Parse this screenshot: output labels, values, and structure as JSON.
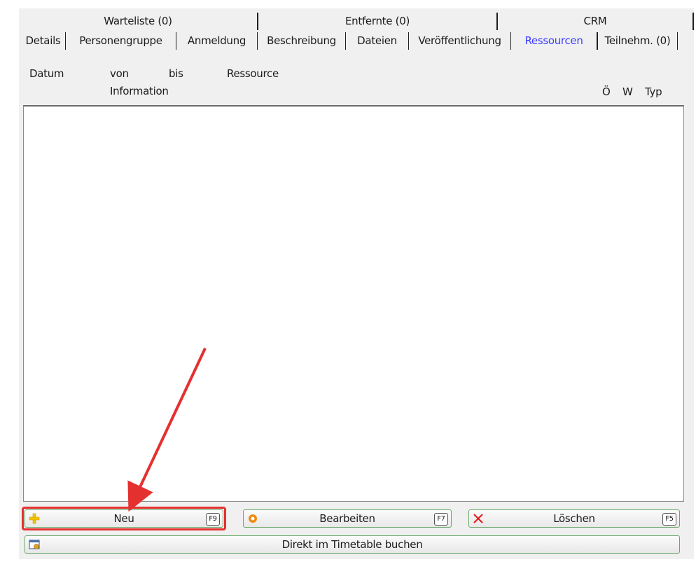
{
  "tabs_top": [
    "Warteliste (0)",
    "Entfernte (0)",
    "CRM"
  ],
  "tabs_bottom": [
    "Details",
    "Personengruppe",
    "Anmeldung",
    "Beschreibung",
    "Dateien",
    "Veröffentlichung",
    "Ressourcen",
    "Teilnehm. (0)"
  ],
  "active_tab": "Ressourcen",
  "list_header": {
    "datum": "Datum",
    "von": "von",
    "bis": "bis",
    "ressource": "Ressource",
    "information": "Information",
    "oe": "Ö",
    "w": "W",
    "typ": "Typ"
  },
  "buttons": {
    "neu": {
      "label": "Neu",
      "key": "F9"
    },
    "bearbeiten": {
      "label": "Bearbeiten",
      "key": "F7"
    },
    "loeschen": {
      "label": "Löschen",
      "key": "F5"
    },
    "timetable": {
      "label": "Direkt im Timetable buchen"
    }
  },
  "colors": {
    "active_tab": "#3d3dff",
    "annotation": "#e53030",
    "button_border": "#6aa86a"
  },
  "icons": {
    "neu": "plus-icon",
    "bearbeiten": "edit-gear-icon",
    "loeschen": "delete-x-icon",
    "timetable": "calendar-icon"
  }
}
